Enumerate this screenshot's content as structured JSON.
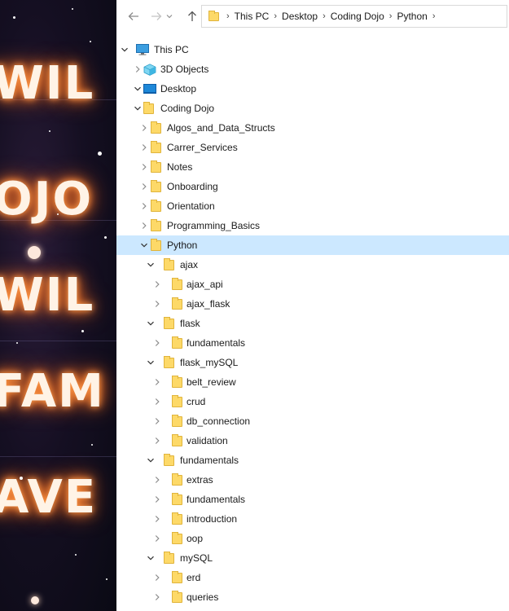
{
  "wallpaper": {
    "words": [
      "WIL",
      "OJO",
      "WIL",
      "FAM",
      "AVE"
    ]
  },
  "address_bar": {
    "crumbs": [
      "This PC",
      "Desktop",
      "Coding Dojo",
      "Python"
    ]
  },
  "tree": [
    {
      "label": "This PC",
      "level": 0,
      "icon": "pc-icon",
      "expanded": true
    },
    {
      "label": "3D Objects",
      "level": 1,
      "icon": "3d-objects-icon",
      "expanded": false
    },
    {
      "label": "Desktop",
      "level": 1,
      "icon": "desktop-icon",
      "expanded": true
    },
    {
      "label": "Coding Dojo",
      "level": 2,
      "icon": "folder-icon",
      "expanded": true
    },
    {
      "label": "Algos_and_Data_Structs",
      "level": 3,
      "icon": "folder-icon",
      "expanded": false
    },
    {
      "label": "Carrer_Services",
      "level": 3,
      "icon": "folder-icon",
      "expanded": false
    },
    {
      "label": "Notes",
      "level": 3,
      "icon": "folder-icon",
      "expanded": false
    },
    {
      "label": "Onboarding",
      "level": 3,
      "icon": "folder-icon",
      "expanded": false
    },
    {
      "label": "Orientation",
      "level": 3,
      "icon": "folder-icon",
      "expanded": false
    },
    {
      "label": "Programming_Basics",
      "level": 3,
      "icon": "folder-icon",
      "expanded": false
    },
    {
      "label": "Python",
      "level": 3,
      "icon": "folder-icon",
      "expanded": true,
      "selected": true
    },
    {
      "label": "ajax",
      "level": 4,
      "icon": "folder-icon",
      "expanded": true
    },
    {
      "label": "ajax_api",
      "level": 5,
      "icon": "folder-icon",
      "expanded": false
    },
    {
      "label": "ajax_flask",
      "level": 5,
      "icon": "folder-icon",
      "expanded": false
    },
    {
      "label": "flask",
      "level": 4,
      "icon": "folder-icon",
      "expanded": true
    },
    {
      "label": "fundamentals",
      "level": 5,
      "icon": "folder-icon",
      "expanded": false
    },
    {
      "label": "flask_mySQL",
      "level": 4,
      "icon": "folder-icon",
      "expanded": true
    },
    {
      "label": "belt_review",
      "level": 5,
      "icon": "folder-icon",
      "expanded": false
    },
    {
      "label": "crud",
      "level": 5,
      "icon": "folder-icon",
      "expanded": false
    },
    {
      "label": "db_connection",
      "level": 5,
      "icon": "folder-icon",
      "expanded": false
    },
    {
      "label": "validation",
      "level": 5,
      "icon": "folder-icon",
      "expanded": false
    },
    {
      "label": "fundamentals",
      "level": 4,
      "icon": "folder-icon",
      "expanded": true
    },
    {
      "label": "extras",
      "level": 5,
      "icon": "folder-icon",
      "expanded": false
    },
    {
      "label": "fundamentals",
      "level": 5,
      "icon": "folder-icon",
      "expanded": false
    },
    {
      "label": "introduction",
      "level": 5,
      "icon": "folder-icon",
      "expanded": false
    },
    {
      "label": "oop",
      "level": 5,
      "icon": "folder-icon",
      "expanded": false
    },
    {
      "label": "mySQL",
      "level": 4,
      "icon": "folder-icon",
      "expanded": true
    },
    {
      "label": "erd",
      "level": 5,
      "icon": "folder-icon",
      "expanded": false
    },
    {
      "label": "queries",
      "level": 5,
      "icon": "folder-icon",
      "expanded": false
    }
  ],
  "colors": {
    "selection": "#cce8ff",
    "folder": "#fdd968",
    "folder_border": "#e0b43c"
  }
}
